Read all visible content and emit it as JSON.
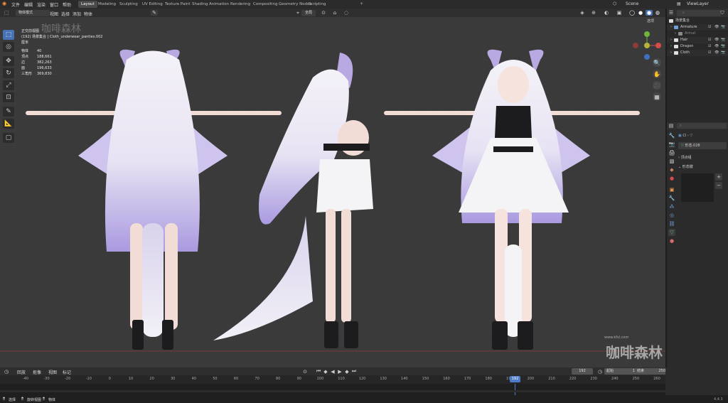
{
  "menus": [
    "文件",
    "编辑",
    "渲染",
    "窗口",
    "帮助"
  ],
  "workspaces": [
    "Layout",
    "Modeling",
    "Sculpting",
    "UV Editing",
    "Texture Paint",
    "Shading",
    "Animation",
    "Rendering",
    "Compositing",
    "Geometry Nodes",
    "Scripting"
  ],
  "active_workspace": "Layout",
  "scene": {
    "label": "Scene",
    "view_layer": "ViewLayer"
  },
  "viewport_header": {
    "mode": "物体模式",
    "view": "视图",
    "select": "选择",
    "add": "添加",
    "object": "物体",
    "transform": "全局",
    "options": "选项"
  },
  "viewport_info": {
    "view": "正交前视图",
    "collection": "(192) 场景集合 | Cloth_underwear_panties.002",
    "unit": "厘米",
    "stats": [
      {
        "k": "物体",
        "v": "40"
      },
      {
        "k": "顶点",
        "v": "188,661"
      },
      {
        "k": "边",
        "v": "382,263"
      },
      {
        "k": "面",
        "v": "196,633"
      },
      {
        "k": "三角形",
        "v": "369,830"
      }
    ]
  },
  "watermark_top": "咖啡森林",
  "watermark_bottom": {
    "site": "www.kfsl.com",
    "name": "咖啡森林"
  },
  "outliner": {
    "root": "场景集合",
    "items": [
      {
        "name": "Armature",
        "depth": 1,
        "color": "#6fa0d8"
      },
      {
        "name": "Armat",
        "depth": 2,
        "color": "#8a8a8a"
      },
      {
        "name": "Hair",
        "depth": 1,
        "color": "#e0e0e0"
      },
      {
        "name": "Dragon",
        "depth": 1,
        "color": "#e0e0e0"
      },
      {
        "name": "Cloth",
        "depth": 1,
        "color": "#e0e0e0"
      }
    ]
  },
  "properties": {
    "object": "Cl",
    "shape": "形态.028",
    "sections": [
      "顶点组",
      "形态键"
    ]
  },
  "timeline": {
    "menus": [
      "回放",
      "抠像",
      "视图",
      "标记"
    ],
    "current_frame": "192",
    "start_label": "起始",
    "start": "1",
    "end_label": "结束",
    "end": "250",
    "ticks": [
      "-40",
      "-30",
      "-20",
      "-10",
      "0",
      "10",
      "20",
      "30",
      "40",
      "50",
      "60",
      "70",
      "80",
      "90",
      "100",
      "110",
      "120",
      "130",
      "140",
      "150",
      "160",
      "170",
      "180",
      "190",
      "200",
      "210",
      "220",
      "230",
      "240",
      "250",
      "260"
    ]
  },
  "statusbar": {
    "select": "选择",
    "rotate": "旋转视图",
    "context": "物体",
    "version": "4.4.3"
  },
  "colors": {
    "accent": "#4772b3",
    "frame": "#4d7cc9",
    "bg": "#3a3a3a"
  }
}
